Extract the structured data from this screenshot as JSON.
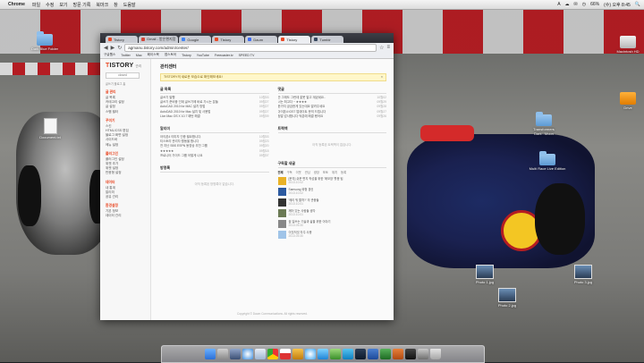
{
  "menubar": {
    "app_name": "Chrome",
    "items": [
      "파일",
      "수정",
      "보기",
      "방문 기록",
      "북마크",
      "창",
      "도움말"
    ],
    "right_items": [
      "A",
      "☁",
      "✉",
      "◷",
      "66%",
      "(수) 오후 8:45",
      "🔍"
    ]
  },
  "desktop_icons": [
    {
      "name": "desktop-folder-icon",
      "label": "Dark Blue Folder",
      "kind": "folder"
    },
    {
      "name": "desktop-document-icon",
      "label": "Document.txt",
      "kind": "doc"
    },
    {
      "name": "desktop-hdd-icon",
      "label": "Macintosh HD",
      "kind": "drive"
    },
    {
      "name": "desktop-orange-drive-icon",
      "label": "Drive",
      "kind": "drive-orange"
    },
    {
      "name": "desktop-folder-icon-2",
      "label": "Transformers Dark...Moon",
      "kind": "folder"
    },
    {
      "name": "desktop-folder-icon-3",
      "label": "Multi Race Live Edition",
      "kind": "folder"
    },
    {
      "name": "desktop-photo-icon",
      "label": "Photo 1.jpg",
      "kind": "thumb"
    },
    {
      "name": "desktop-photo-icon-2",
      "label": "Photo 2.jpg",
      "kind": "thumb"
    },
    {
      "name": "desktop-photo-icon-3",
      "label": "Photo 3.jpg",
      "kind": "thumb"
    }
  ],
  "browser": {
    "tabs": [
      {
        "label": "Tistory",
        "active": false
      },
      {
        "label": "Gmail - 받은편지함",
        "active": false
      },
      {
        "label": "Google",
        "active": false
      },
      {
        "label": "Tistory",
        "active": false
      },
      {
        "label": "Daum",
        "active": false
      },
      {
        "label": "Tistory",
        "active": true
      },
      {
        "label": "Tumblr",
        "active": false
      }
    ],
    "url": "agmanu.tistory.com/admin/center/",
    "bookmarks": [
      "구글웹스",
      "Twitter",
      "Mac",
      "페이스북",
      "앱스토어",
      "Tistory",
      "YouTube",
      "Freecaster.tv",
      "SPEED TV"
    ]
  },
  "sidebar": {
    "logo_prefix": "T",
    "logo_rest": "ISTORY",
    "logo_sub": "관리",
    "select_placeholder": "closed",
    "top_links": "글쓰기  블로그 홈",
    "groups": [
      {
        "head": "글 관리",
        "items": [
          "글 목록",
          "카테고리 설정",
          "글 설정",
          "스팸 필터"
        ]
      },
      {
        "head": "꾸미기",
        "items": [
          "스킨",
          "HTML/CSS 편집",
          "블로그 화면 설정",
          "사이드바",
          "메뉴 설정"
        ]
      },
      {
        "head": "플러그인",
        "items": [
          "플러그인 설정",
          "위젯 추가",
          "위젯 설정",
          "반응형 설정"
        ]
      },
      {
        "head": "데이터",
        "items": [
          "내 통계",
          "알리미",
          "공유 관리"
        ]
      },
      {
        "head": "환경설정",
        "items": [
          "기본 정보",
          "데이터 관리"
        ]
      }
    ]
  },
  "main": {
    "title": "관리센터",
    "notice": "TISTORY의 새로운 모습으로 확인해보세요!",
    "notice_close": "×",
    "recent_posts": {
      "title": "글 목록",
      "rows": [
        {
          "t": "글쓰기 발행",
          "d": "10월03"
        },
        {
          "t": "글쓰기 준비중 인데 글쓰기에 바로 가시는 분들",
          "d": "09월27"
        },
        {
          "t": "AutoCAD 2010 for MAC 설치 방법",
          "d": "09월27"
        },
        {
          "t": "AutoDAD 2010 for Mac 설치 및 사용법",
          "d": "09월27"
        },
        {
          "t": "Lion Mac OS X 10.7 패턴 해결",
          "d": "09월09"
        }
      ]
    },
    "notifications": {
      "title": "알리미",
      "rows": [
        {
          "t": "아이폰4 이미지 인증 필요합니다.",
          "d": "10월03"
        },
        {
          "t": "티스토리 관리자 활동을 합니다",
          "d": "09월23"
        },
        {
          "t": "전 지난 SBS ESPN 동영상 추천 그룹",
          "d": "09월20"
        },
        {
          "t": "★★★★★",
          "d": "09월18"
        },
        {
          "t": "프로니터 가이드 그룹 어떻게 나요",
          "d": "09월07"
        }
      ]
    },
    "guestbook": {
      "title": "방명록",
      "empty": "아직 등록된 방명록이 없습니다."
    },
    "comments": {
      "title": "댓글",
      "rows": [
        {
          "t": "안 그래도 그런데 잘못 알고 계셨네요..",
          "d": "10월02"
        },
        {
          "t": "너는 최고다 ~ ★★★★",
          "d": "09월29"
        },
        {
          "t": "한가지 궁금한게 있는데요 알려주세요",
          "d": "09월28"
        },
        {
          "t": "아이폰4 iOS7 업데이트 문의 드립니다",
          "d": "09월27"
        },
        {
          "t": "정말 감사합니다 덕분에 해결 됐어요",
          "d": "09월26"
        }
      ]
    },
    "trackback": {
      "title": "트랙백",
      "empty": "아직 등록된 트랙백이 없습니다."
    },
    "feed": {
      "title": "구독할 새글",
      "filters": [
        "전체",
        "구독",
        "이웃",
        "관심",
        "광장",
        "포토",
        "위치",
        "등록"
      ],
      "items": [
        {
          "t": "[문자] 쉬운 편지 작성을 위한 '메모장' 활용 팁",
          "d": "2013.10.02"
        },
        {
          "t": "Samsung 외형 갱신",
          "d": "2013.10.02"
        },
        {
          "t": "'메리 뭐 할까?' 의 관중들",
          "d": "2013.10.01"
        },
        {
          "t": "깨어 있는 사람들 생각",
          "d": "2013.10.01"
        },
        {
          "t": "꿈 일쓰는 기술과 삶을 위한 이야기",
          "d": "2013.09.30"
        },
        {
          "t": "이것저것 자주 사용",
          "d": "2013.09.30"
        }
      ]
    },
    "footer": "Copyright © Daum Communications. All rights reserved."
  },
  "dock_items": [
    "finder",
    "launchpad",
    "mission",
    "safari",
    "mail",
    "chrome",
    "ical",
    "photos",
    "itunes",
    "messages",
    "facetime",
    "skype",
    "photoshop",
    "word",
    "excel",
    "powerpoint",
    "terminal",
    "preferences",
    "trash"
  ]
}
